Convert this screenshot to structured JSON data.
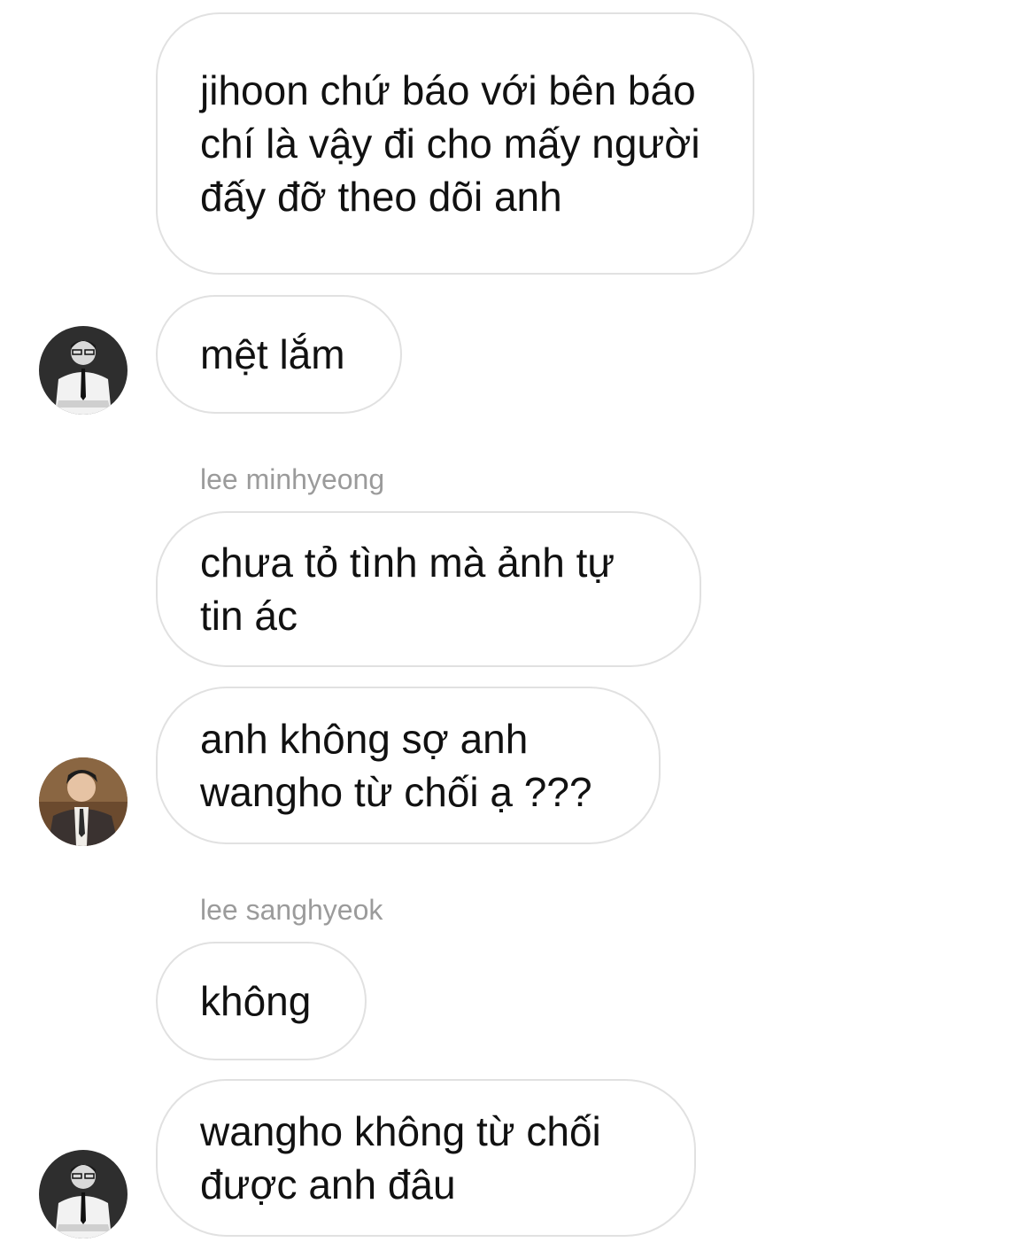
{
  "chat": {
    "messages": [
      {
        "text": "jihoon chứ báo với bên báo chí là vậy đi cho mấy người đấy đỡ theo dõi anh"
      },
      {
        "text": "mệt lắm"
      },
      {
        "sender": "lee minhyeong",
        "text": "chưa tỏ tình mà ảnh tự tin ác"
      },
      {
        "text": "anh không sợ anh wangho từ chối ạ ???"
      },
      {
        "sender": "lee sanghyeok",
        "text": "không"
      },
      {
        "text": "wangho không từ chối được anh đâu"
      }
    ]
  },
  "colors": {
    "bubble_border": "#e1e1e1",
    "sender_text": "#9b9b9b",
    "message_text": "#111111"
  }
}
